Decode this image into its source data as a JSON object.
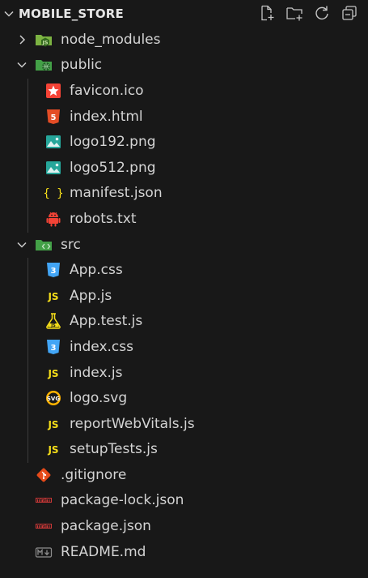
{
  "explorer": {
    "title": "MOBILE_STORE",
    "actions": [
      "new-file-icon",
      "new-folder-icon",
      "refresh-icon",
      "collapse-all-icon"
    ]
  },
  "colors": {
    "background": "#181818",
    "text": "#d4d4d4",
    "node_folder": "#8bc34a",
    "folder_green": "#4caf50",
    "js_yellow": "#f5de19",
    "css_blue": "#42a5f5",
    "html_orange": "#e44d26",
    "png_teal": "#26a69a",
    "npm_red": "#cb3837",
    "git_red": "#e64a19"
  },
  "tree": {
    "node_modules": {
      "label": "node_modules",
      "icon": "node-folder-icon"
    },
    "public": {
      "label": "public",
      "icon": "public-folder-icon",
      "children": [
        {
          "label": "favicon.ico",
          "icon": "favicon-icon"
        },
        {
          "label": "index.html",
          "icon": "html-icon"
        },
        {
          "label": "logo192.png",
          "icon": "image-icon"
        },
        {
          "label": "logo512.png",
          "icon": "image-icon"
        },
        {
          "label": "manifest.json",
          "icon": "json-icon"
        },
        {
          "label": "robots.txt",
          "icon": "robots-icon"
        }
      ]
    },
    "src": {
      "label": "src",
      "icon": "src-folder-icon",
      "children": [
        {
          "label": "App.css",
          "icon": "css-icon"
        },
        {
          "label": "App.js",
          "icon": "js-icon"
        },
        {
          "label": "App.test.js",
          "icon": "test-js-icon"
        },
        {
          "label": "index.css",
          "icon": "css-icon"
        },
        {
          "label": "index.js",
          "icon": "js-icon"
        },
        {
          "label": "logo.svg",
          "icon": "svg-icon"
        },
        {
          "label": "reportWebVitals.js",
          "icon": "js-icon"
        },
        {
          "label": "setupTests.js",
          "icon": "js-icon"
        }
      ]
    },
    "root_files": [
      {
        "label": ".gitignore",
        "icon": "git-icon"
      },
      {
        "label": "package-lock.json",
        "icon": "npm-icon"
      },
      {
        "label": "package.json",
        "icon": "npm-icon"
      },
      {
        "label": "README.md",
        "icon": "markdown-icon"
      }
    ]
  }
}
